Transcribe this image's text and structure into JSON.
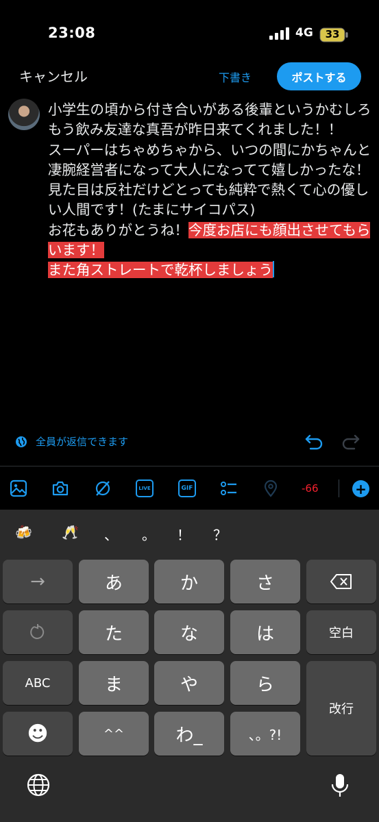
{
  "status_bar": {
    "time": "23:08",
    "network": "4G",
    "battery": "33"
  },
  "header": {
    "cancel_label": "キャンセル",
    "drafts_label": "下書き",
    "post_label": "ポストする"
  },
  "tweet": {
    "text_plain": "小学生の頃から付き合いがある後輩というかむしろもう飲み友達な真吾が昨日来てくれました！！\nスーパーはちゃめちゃから、いつの間にかちゃんと凄腕経営者になって大人になってて嬉しかったな！\n見た目は反社だけどとっても純粋で熱くて心の優しい人間です！(たまにサイコパス)\nお花もありがとうね！",
    "text_selected": "今度お店にも顔出させてもらいます！\nまた角ストレートで乾杯しましょう"
  },
  "reply_setting": {
    "label": "全員が返信できます",
    "icon": "globe-icon"
  },
  "toolbar": {
    "icons": [
      "image-icon",
      "camera-icon",
      "grok-icon",
      "live-icon",
      "gif-icon",
      "poll-icon",
      "location-icon"
    ],
    "live_label": "LIVE",
    "gif_label": "GIF",
    "char_count": "-66",
    "accent_color": "#1d9bf0",
    "warning_color": "#f4212e"
  },
  "keyboard": {
    "candidates": [
      "🍻",
      "🥂",
      "、",
      "。",
      "！",
      "？"
    ],
    "keys": {
      "arrow": "→",
      "a": "あ",
      "ka": "か",
      "sa": "さ",
      "ta": "た",
      "na": "な",
      "ha": "は",
      "space": "空白",
      "abc": "ABC",
      "ma": "ま",
      "ya": "や",
      "ra": "ら",
      "return": "改行",
      "emoji": "☻",
      "dakuten": "^^",
      "wa": "わ_",
      "punct": "、。?!"
    }
  }
}
